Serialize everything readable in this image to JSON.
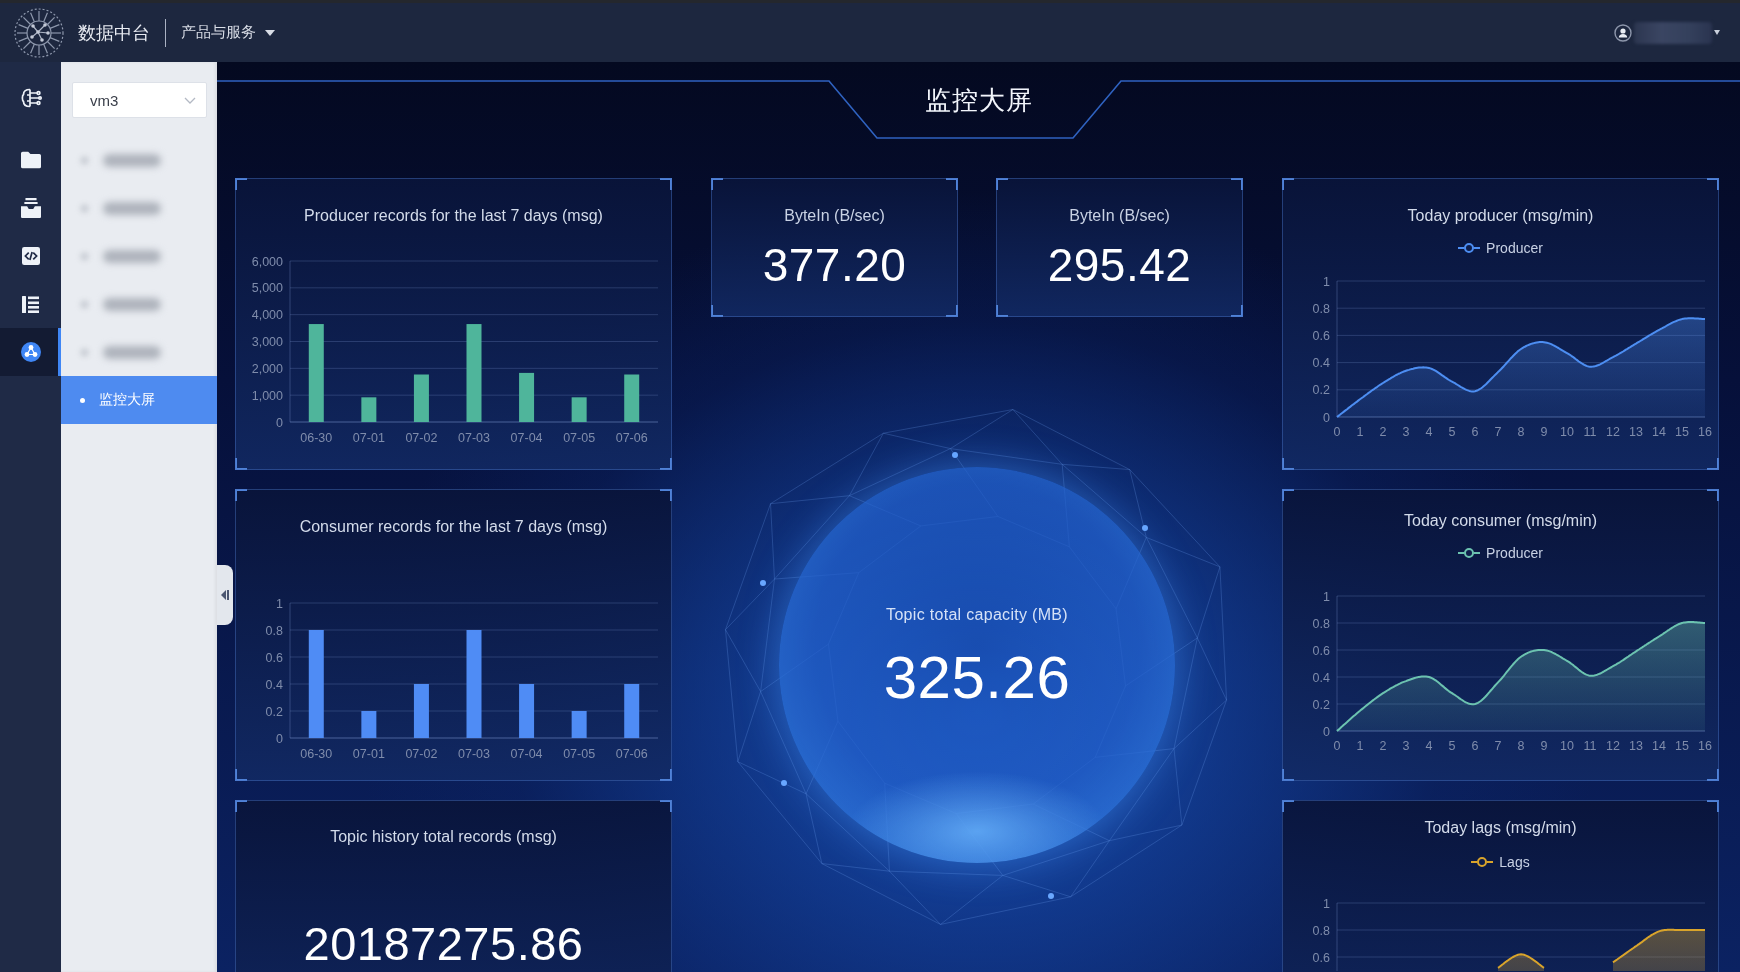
{
  "header": {
    "app_name": "数据中台",
    "menu": "产品与服务"
  },
  "rail": [
    {
      "kind": "circuit",
      "selected": false
    },
    {
      "kind": "folder",
      "selected": false
    },
    {
      "kind": "tray",
      "selected": false
    },
    {
      "kind": "code",
      "selected": false
    },
    {
      "kind": "list",
      "selected": false
    },
    {
      "kind": "nodes",
      "selected": true
    }
  ],
  "sidebar": {
    "select": {
      "value": "vm3"
    },
    "items": [
      {
        "kind": "blurred",
        "selected": false
      },
      {
        "kind": "blurred",
        "selected": false
      },
      {
        "kind": "blurred",
        "selected": false
      },
      {
        "kind": "blurred",
        "selected": false
      },
      {
        "kind": "blurred",
        "selected": false
      },
      {
        "kind": "page",
        "label": "监控大屏",
        "selected": true
      }
    ]
  },
  "page_title": "监控大屏",
  "left_panels": [
    {
      "kind": "chart",
      "chart_data": {
        "type": "bar",
        "title": "Producer records for the last 7 days (msg)",
        "categories": [
          "06-30",
          "07-01",
          "07-02",
          "07-03",
          "07-04",
          "07-05",
          "07-06"
        ],
        "series": [
          {
            "color": "#4fb59b",
            "values": [
              3650,
              920,
              1770,
              3650,
              1830,
              920,
              1770
            ]
          }
        ],
        "ylim": [
          0,
          6000
        ],
        "yticks": [
          0,
          {
            "value": 1000,
            "label": "1,000"
          },
          {
            "value": 2000,
            "label": "2,000"
          },
          {
            "value": 3000,
            "label": "3,000"
          },
          {
            "value": 4000,
            "label": "4,000"
          },
          {
            "value": 5000,
            "label": "5,000"
          },
          {
            "value": 6000,
            "label": "6,000"
          }
        ],
        "grid": true
      }
    },
    {
      "kind": "chart",
      "chart_data": {
        "type": "bar",
        "title": "Consumer records for the last 7 days (msg)",
        "categories": [
          "06-30",
          "07-01",
          "07-02",
          "07-03",
          "07-04",
          "07-05",
          "07-06"
        ],
        "series": [
          {
            "color": "#4f8cf5",
            "values": [
              0.8,
              0.2,
              0.4,
              0.8,
              0.4,
              0.2,
              0.4
            ]
          }
        ],
        "ylim": [
          0,
          1
        ],
        "yticks": [
          0,
          0.2,
          0.4,
          0.6,
          0.8,
          1
        ],
        "grid": true
      }
    },
    {
      "kind": "total",
      "title": "Topic history total records (msg)",
      "value": "20187275.86"
    }
  ],
  "stats": [
    {
      "label": "ByteIn (B/sec)",
      "value": "377.20"
    },
    {
      "label": "ByteIn (B/sec)",
      "value": "295.42"
    }
  ],
  "capacity": {
    "label": "Topic total capacity (MB)",
    "value": "325.26"
  },
  "right_panels": [
    {
      "chart_data": {
        "type": "area",
        "title": "Today producer (msg/min)",
        "x": [
          0,
          1,
          2,
          3,
          4,
          5,
          6,
          7,
          8,
          9,
          10,
          11,
          12,
          13,
          14,
          15,
          16
        ],
        "series": [
          {
            "name": "Producer",
            "color": "#4d8ef2",
            "values": [
              0,
              0.13,
              0.25,
              0.34,
              0.36,
              0.26,
              0.19,
              0.33,
              0.5,
              0.55,
              0.47,
              0.37,
              0.44,
              0.54,
              0.64,
              0.72,
              0.72
            ]
          }
        ],
        "ylim": [
          0,
          1
        ],
        "yticks": [
          0,
          0.2,
          0.4,
          0.6,
          0.8,
          1
        ],
        "grid": true
      }
    },
    {
      "chart_data": {
        "type": "area",
        "title": "Today consumer (msg/min)",
        "x": [
          0,
          1,
          2,
          3,
          4,
          5,
          6,
          7,
          8,
          9,
          10,
          11,
          12,
          13,
          14,
          15,
          16
        ],
        "series": [
          {
            "name": "Producer",
            "color": "#6cc3b0",
            "values": [
              0,
              0.15,
              0.28,
              0.37,
              0.4,
              0.28,
              0.2,
              0.36,
              0.55,
              0.6,
              0.52,
              0.41,
              0.48,
              0.59,
              0.7,
              0.8,
              0.8
            ]
          }
        ],
        "ylim": [
          0,
          1
        ],
        "yticks": [
          0,
          0.2,
          0.4,
          0.6,
          0.8,
          1
        ],
        "grid": true
      }
    },
    {
      "chart_data": {
        "type": "area",
        "title": "Today lags (msg/min)",
        "series": [
          {
            "name": "Lags",
            "color": "#d9a42b",
            "values": [
              null,
              null,
              null,
              null,
              null,
              null,
              null,
              0.52,
              0.62,
              0.52,
              null,
              null,
              0.56,
              0.68,
              0.79,
              0.8,
              0.8
            ]
          }
        ],
        "ylim": [
          0,
          1
        ],
        "yticks": [
          0.6,
          0.8,
          1
        ],
        "grid": true
      }
    }
  ]
}
